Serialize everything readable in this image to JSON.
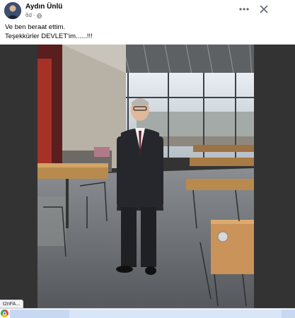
{
  "post": {
    "author": "Aydın Ünlü",
    "time": "6d",
    "dot": "·",
    "text_line_1": "Ve ben beraat ettim.",
    "text_line_2": "Teşekkürler DEVLET'im......!!!"
  },
  "status_bar": {
    "url_fragment": "t2nFA..."
  },
  "icons": {
    "avatar": "avatar-photo",
    "visibility": "globe-icon",
    "more": "more-options-icon",
    "close": "close-icon",
    "browser": "chrome-icon"
  },
  "colors": {
    "author_text": "#050505",
    "meta_text": "#65676b",
    "photo_backdrop": "#333333",
    "card_background": "#ffffff"
  }
}
